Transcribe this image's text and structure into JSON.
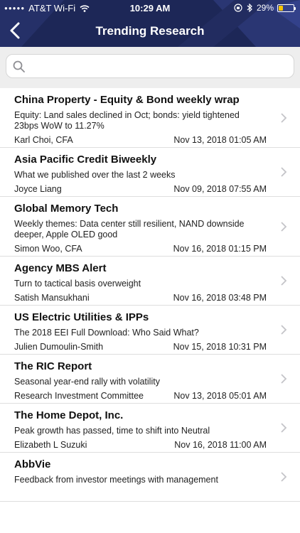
{
  "status_bar": {
    "carrier": "AT&T Wi-Fi",
    "time": "10:29 AM",
    "battery": "29%",
    "battery_level": 0.29
  },
  "nav": {
    "title": "Trending Research"
  },
  "search": {
    "placeholder": ""
  },
  "items": [
    {
      "title": "China Property - Equity & Bond weekly wrap",
      "description": "Equity: Land sales declined in Oct; bonds: yield tightened 23bps WoW to 11.27%",
      "author": "Karl Choi, CFA",
      "date": "Nov 13, 2018 01:05 AM"
    },
    {
      "title": "Asia Pacific Credit Biweekly",
      "description": "What we published over the last 2 weeks",
      "author": "Joyce Liang",
      "date": "Nov 09, 2018 07:55 AM"
    },
    {
      "title": "Global Memory Tech",
      "description": "Weekly themes: Data center still resilient, NAND downside deeper, Apple OLED good",
      "author": "Simon Woo, CFA",
      "date": "Nov 16, 2018 01:15 PM"
    },
    {
      "title": "Agency MBS Alert",
      "description": "Turn to tactical basis overweight",
      "author": "Satish Mansukhani",
      "date": "Nov 16, 2018 03:48 PM"
    },
    {
      "title": "US Electric Utilities & IPPs",
      "description": "The 2018 EEI Full Download: Who Said What?",
      "author": "Julien Dumoulin-Smith",
      "date": "Nov 15, 2018 10:31 PM"
    },
    {
      "title": "The RIC Report",
      "description": "Seasonal year-end rally with volatility",
      "author": "Research Investment Committee",
      "date": "Nov 13, 2018 05:01 AM"
    },
    {
      "title": "The Home Depot, Inc.",
      "description": "Peak growth has passed, time to shift into Neutral",
      "author": "Elizabeth L Suzuki",
      "date": "Nov 16, 2018 11:00 AM"
    },
    {
      "title": "AbbVie",
      "description": "Feedback from investor meetings with management",
      "author": "",
      "date": ""
    }
  ],
  "colors": {
    "header_bg": "#1d2757",
    "search_bg": "#eeeeee",
    "divider": "#dedede"
  }
}
